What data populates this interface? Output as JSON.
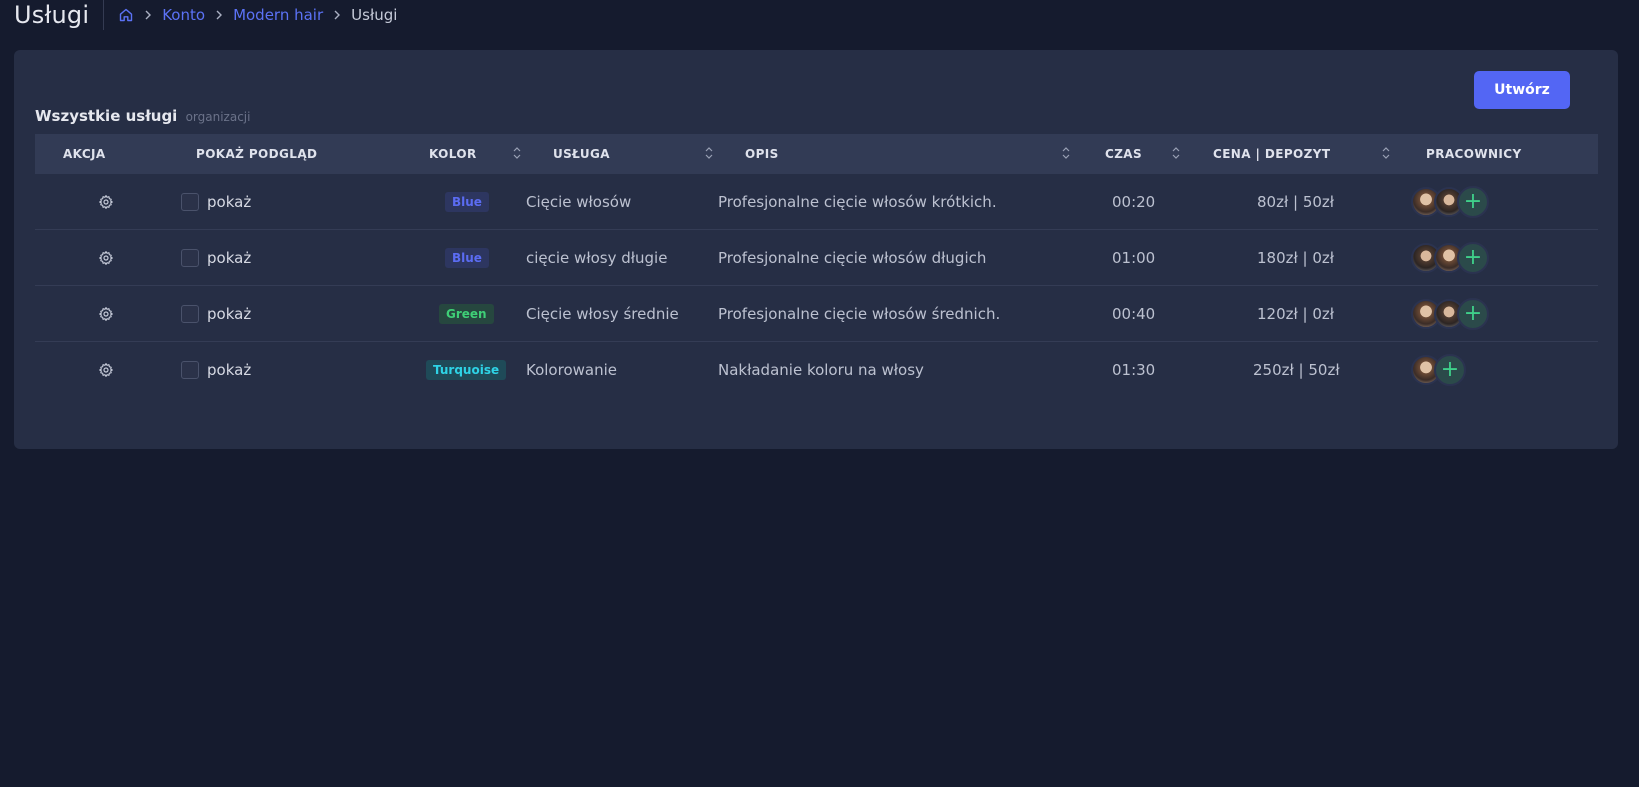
{
  "header": {
    "title": "Usługi",
    "breadcrumb": [
      {
        "label": "Konto"
      },
      {
        "label": "Modern hair"
      },
      {
        "label": "Usługi"
      }
    ]
  },
  "card": {
    "title": "Wszystkie usługi",
    "subtitle": "organizacji",
    "create_label": "Utwórz"
  },
  "table": {
    "columns": {
      "akcja": "AKCJA",
      "podglad": "POKAŻ PODGLĄD",
      "kolor": "KOLOR",
      "usluga": "USŁUGA",
      "opis": "OPIS",
      "czas": "CZAS",
      "cena": "CENA | DEPOZYT",
      "pracownicy": "PRACOWNICY"
    },
    "rows": [
      {
        "show": "pokaż",
        "color": "Blue",
        "service": "Cięcie włosów",
        "desc": "Profesjonalne cięcie włosów krótkich.",
        "time": "00:20",
        "price": "80zł | 50zł"
      },
      {
        "show": "pokaż",
        "color": "Blue",
        "service": "cięcie włosy długie",
        "desc": "Profesjonalne cięcie włosów długich",
        "time": "01:00",
        "price": "180zł | 0zł"
      },
      {
        "show": "pokaż",
        "color": "Green",
        "service": "Cięcie włosy średnie",
        "desc": "Profesjonalne cięcie włosów średnich.",
        "time": "00:40",
        "price": "120zł | 0zł"
      },
      {
        "show": "pokaż",
        "color": "Turquoise",
        "service": "Kolorowanie",
        "desc": "Nakładanie koloru na włosy",
        "time": "01:30",
        "price": "250zł | 50zł"
      }
    ]
  },
  "colors": {
    "background": "#151b2e",
    "card": "#262e45",
    "accent": "#5366f4",
    "badge_blue_text": "#5b6cf2",
    "badge_blue_bg": "#2d3660",
    "badge_green_text": "#3fcf77",
    "badge_green_bg": "#26473f",
    "badge_turquoise_text": "#2ed3e6",
    "badge_turquoise_bg": "#1f4a58"
  },
  "icons": [
    "home-icon",
    "chevron-right-icon",
    "sort-icon",
    "gear-icon",
    "plus-icon"
  ]
}
